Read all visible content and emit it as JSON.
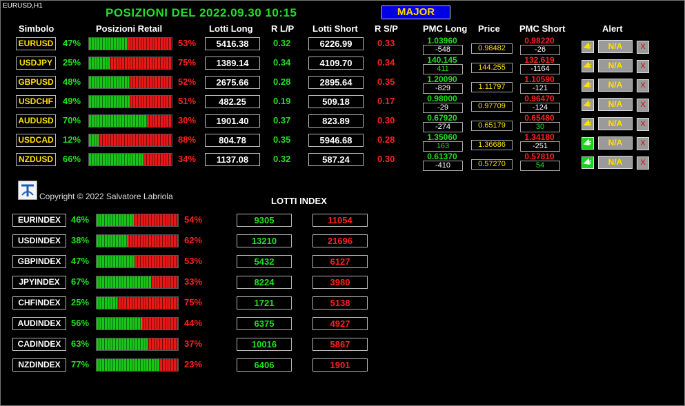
{
  "chart_label": "EURUSD,H1",
  "title": "POSIZIONI  DEL   2022.09.30 10:15",
  "major_button": "MAJOR",
  "headers": {
    "simbolo": "Simbolo",
    "posizioni": "Posizioni Retail",
    "lotti_long": "Lotti Long",
    "rlp": "R L/P",
    "lotti_short": "Lotti Short",
    "rsp": "R S/P",
    "pmc_long": "PMC Long",
    "price": "Price",
    "pmc_short": "PMC Short",
    "alert": "Alert"
  },
  "pairs": [
    {
      "symbol": "EURUSD",
      "long_pct": "47%",
      "short_pct": "53%",
      "long_frac": 0.47,
      "lotti_long": "5416.38",
      "rlp": "0.32",
      "lotti_short": "6226.99",
      "rsp": "0.33",
      "pmc_long": "1.03960",
      "pmc_long_diff": "-548",
      "pmc_long_diff_color": "#ffffff",
      "price": "0.98482",
      "pmc_short": "0.98220",
      "pmc_short_diff": "-26",
      "pmc_short_diff_color": "#ffffff",
      "alert_on": false,
      "na": "N/A",
      "x": "X"
    },
    {
      "symbol": "USDJPY",
      "long_pct": "25%",
      "short_pct": "75%",
      "long_frac": 0.25,
      "lotti_long": "1389.14",
      "rlp": "0.34",
      "lotti_short": "4109.70",
      "rsp": "0.34",
      "pmc_long": "140.145",
      "pmc_long_diff": "411",
      "pmc_long_diff_color": "#20e020",
      "price": "144.255",
      "pmc_short": "132.619",
      "pmc_short_diff": "-1164",
      "pmc_short_diff_color": "#ffffff",
      "alert_on": false,
      "na": "N/A",
      "x": "X"
    },
    {
      "symbol": "GBPUSD",
      "long_pct": "48%",
      "short_pct": "52%",
      "long_frac": 0.48,
      "lotti_long": "2675.66",
      "rlp": "0.28",
      "lotti_short": "2895.64",
      "rsp": "0.35",
      "pmc_long": "1.20090",
      "pmc_long_diff": "-829",
      "pmc_long_diff_color": "#ffffff",
      "price": "1.11797",
      "pmc_short": "1.10590",
      "pmc_short_diff": "-121",
      "pmc_short_diff_color": "#ffffff",
      "alert_on": false,
      "na": "N/A",
      "x": "X"
    },
    {
      "symbol": "USDCHF",
      "long_pct": "49%",
      "short_pct": "51%",
      "long_frac": 0.49,
      "lotti_long": "482.25",
      "rlp": "0.19",
      "lotti_short": "509.18",
      "rsp": "0.17",
      "pmc_long": "0.98000",
      "pmc_long_diff": "-29",
      "pmc_long_diff_color": "#ffffff",
      "price": "0.97709",
      "pmc_short": "0.96470",
      "pmc_short_diff": "-124",
      "pmc_short_diff_color": "#ffffff",
      "alert_on": false,
      "na": "N/A",
      "x": "X"
    },
    {
      "symbol": "AUDUSD",
      "long_pct": "70%",
      "short_pct": "30%",
      "long_frac": 0.7,
      "lotti_long": "1901.40",
      "rlp": "0.37",
      "lotti_short": "823.89",
      "rsp": "0.30",
      "pmc_long": "0.67920",
      "pmc_long_diff": "-274",
      "pmc_long_diff_color": "#ffffff",
      "price": "0.65179",
      "pmc_short": "0.65480",
      "pmc_short_diff": "30",
      "pmc_short_diff_color": "#20e020",
      "alert_on": false,
      "na": "N/A",
      "x": "X"
    },
    {
      "symbol": "USDCAD",
      "long_pct": "12%",
      "short_pct": "88%",
      "long_frac": 0.12,
      "lotti_long": "804.78",
      "rlp": "0.35",
      "lotti_short": "5946.68",
      "rsp": "0.28",
      "pmc_long": "1.35060",
      "pmc_long_diff": "163",
      "pmc_long_diff_color": "#20e020",
      "price": "1.36686",
      "pmc_short": "1.34180",
      "pmc_short_diff": "-251",
      "pmc_short_diff_color": "#ffffff",
      "alert_on": true,
      "na": "N/A",
      "x": "X"
    },
    {
      "symbol": "NZDUSD",
      "long_pct": "66%",
      "short_pct": "34%",
      "long_frac": 0.66,
      "lotti_long": "1137.08",
      "rlp": "0.32",
      "lotti_short": "587.24",
      "rsp": "0.30",
      "pmc_long": "0.61370",
      "pmc_long_diff": "-410",
      "pmc_long_diff_color": "#ffffff",
      "price": "0.57270",
      "pmc_short": "0.57810",
      "pmc_short_diff": "54",
      "pmc_short_diff_color": "#20e020",
      "alert_on": true,
      "na": "N/A",
      "x": "X"
    }
  ],
  "copyright": "Copyright © 2022 Salvatore Labriola",
  "lotti_index_title": "LOTTI INDEX",
  "indexes": [
    {
      "symbol": "EURINDEX",
      "long_pct": "46%",
      "short_pct": "54%",
      "long_frac": 0.46,
      "long": "9305",
      "short": "11054"
    },
    {
      "symbol": "USDINDEX",
      "long_pct": "38%",
      "short_pct": "62%",
      "long_frac": 0.38,
      "long": "13210",
      "short": "21696"
    },
    {
      "symbol": "GBPINDEX",
      "long_pct": "47%",
      "short_pct": "53%",
      "long_frac": 0.47,
      "long": "5432",
      "short": "6127"
    },
    {
      "symbol": "JPYINDEX",
      "long_pct": "67%",
      "short_pct": "33%",
      "long_frac": 0.67,
      "long": "8224",
      "short": "3980"
    },
    {
      "symbol": "CHFINDEX",
      "long_pct": "25%",
      "short_pct": "75%",
      "long_frac": 0.25,
      "long": "1721",
      "short": "5138"
    },
    {
      "symbol": "AUDINDEX",
      "long_pct": "56%",
      "short_pct": "44%",
      "long_frac": 0.56,
      "long": "6375",
      "short": "4927"
    },
    {
      "symbol": "CADINDEX",
      "long_pct": "63%",
      "short_pct": "37%",
      "long_frac": 0.63,
      "long": "10016",
      "short": "5867"
    },
    {
      "symbol": "NZDINDEX",
      "long_pct": "77%",
      "short_pct": "23%",
      "long_frac": 0.77,
      "long": "6406",
      "short": "1901"
    }
  ],
  "colors": {
    "green": "#20e020",
    "red": "#ff2020",
    "yellow": "#ffe000",
    "major_bg": "#0000e8"
  },
  "icons": {
    "alert_bell": "alert-bell-icon",
    "logo": "app-logo-icon"
  }
}
